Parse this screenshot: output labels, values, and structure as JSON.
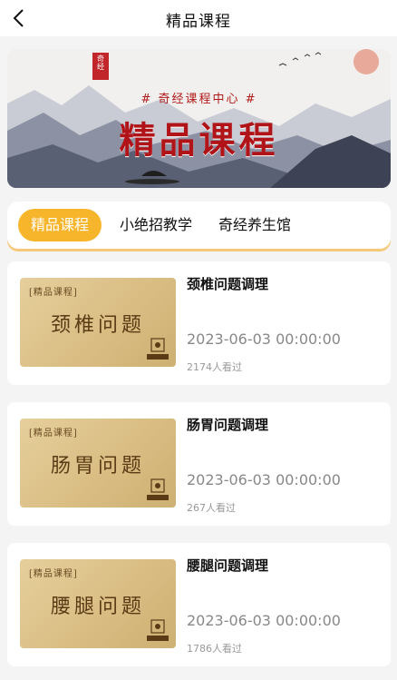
{
  "header": {
    "title": "精品课程"
  },
  "banner": {
    "subtitle": "# 奇经课程中心 #",
    "title": "精品课程",
    "seal": "奇经"
  },
  "tabs": [
    {
      "label": "精品课程",
      "active": true
    },
    {
      "label": "小绝招教学",
      "active": false
    },
    {
      "label": "奇经养生馆",
      "active": false
    }
  ],
  "courses": [
    {
      "tag": "[精品课程]",
      "thumb_title": "颈椎问题",
      "title": "颈椎问题调理",
      "date": "2023-06-03 00:00:00",
      "views": "2174人看过"
    },
    {
      "tag": "[精品课程]",
      "thumb_title": "肠胃问题",
      "title": "肠胃问题调理",
      "date": "2023-06-03 00:00:00",
      "views": "267人看过"
    },
    {
      "tag": "[精品课程]",
      "thumb_title": "腰腿问题",
      "title": "腰腿问题调理",
      "date": "2023-06-03 00:00:00",
      "views": "1786人看过"
    }
  ],
  "colors": {
    "accent": "#f7b52c",
    "banner_red": "#b01419"
  },
  "icons": {
    "back": "chevron-left-icon",
    "logo": "qijing-logo-icon"
  }
}
